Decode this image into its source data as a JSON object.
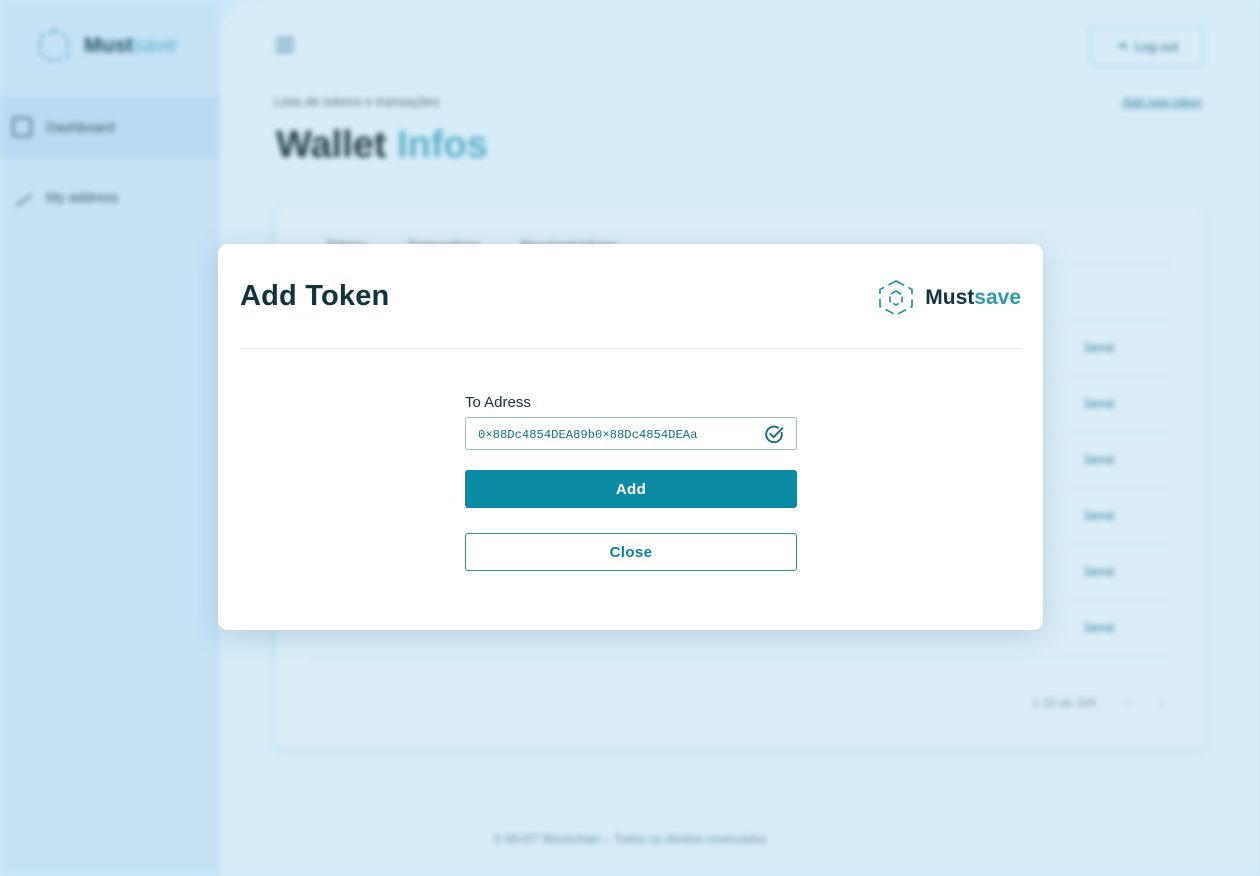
{
  "background": {
    "sidebar": {
      "brand_main": "Must",
      "brand_soft": "save",
      "items": [
        {
          "label": "Dashboard"
        },
        {
          "label": "My address"
        }
      ]
    },
    "header": {
      "logout_label": "Log out"
    },
    "subtitle": "Lista de tokens e transações",
    "add_new_label": "Add new token",
    "title_main": "Wallet",
    "title_accent": "Infos",
    "table": {
      "tabs": [
        "Tokens",
        "Transactions",
        "Received tokens"
      ],
      "row_action_label": "Send",
      "pagination": "1-10 de 100"
    },
    "footer": "© MUST Blockchain – Todos os direitos reservados"
  },
  "modal": {
    "title": "Add Token",
    "brand_main": "Must",
    "brand_soft": "save",
    "field_label": "To Adress",
    "address_value": "0×88Dc4854DEA89b0×88Dc4854DEAa",
    "add_label": "Add",
    "close_label": "Close"
  },
  "colors": {
    "primary": "#0b8aa3",
    "title_text": "#12333c",
    "brand_accent": "#2e9ab2",
    "backdrop": "#cfe8f7"
  }
}
